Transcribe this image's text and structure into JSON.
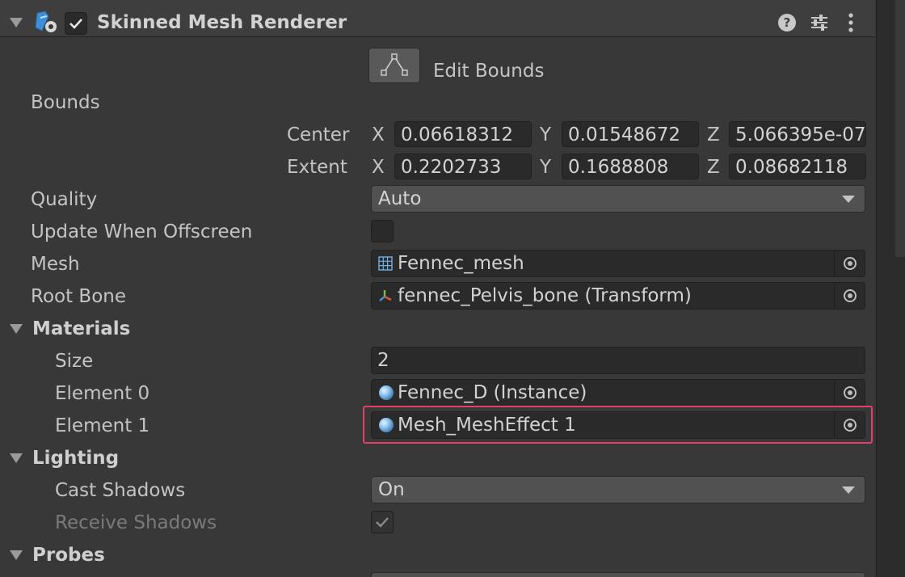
{
  "component": {
    "title": "Skinned Mesh Renderer",
    "enabled": true,
    "header_icons": [
      "component-icon",
      "help-icon",
      "presets-icon",
      "more-icon"
    ]
  },
  "edit_bounds": {
    "label": "Edit Bounds",
    "icon": "bounds-edit-icon"
  },
  "bounds": {
    "label": "Bounds",
    "center": {
      "label": "Center",
      "x_label": "X",
      "x": "0.06618312",
      "y_label": "Y",
      "y": "0.01548672",
      "z_label": "Z",
      "z": "5.066395e-07"
    },
    "extent": {
      "label": "Extent",
      "x_label": "X",
      "x": "0.2202733",
      "y_label": "Y",
      "y": "0.1688808",
      "z_label": "Z",
      "z": "0.08682118"
    }
  },
  "quality": {
    "label": "Quality",
    "value": "Auto"
  },
  "update_offscreen": {
    "label": "Update When Offscreen",
    "checked": false
  },
  "mesh": {
    "label": "Mesh",
    "value": "Fennec_mesh",
    "icon": "mesh-grid-icon"
  },
  "root_bone": {
    "label": "Root Bone",
    "value": "fennec_Pelvis_bone (Transform)",
    "icon": "transform-axes-icon"
  },
  "materials": {
    "label": "Materials",
    "size_label": "Size",
    "size": "2",
    "elements": [
      {
        "label": "Element 0",
        "value": "Fennec_D (Instance)",
        "icon": "material-sphere-icon"
      },
      {
        "label": "Element 1",
        "value": "Mesh_MeshEffect 1",
        "icon": "material-sphere-icon",
        "highlighted": true
      }
    ]
  },
  "lighting": {
    "label": "Lighting",
    "cast_shadows": {
      "label": "Cast Shadows",
      "value": "On"
    },
    "receive_shadows": {
      "label": "Receive Shadows",
      "checked": true,
      "disabled": true
    }
  },
  "probes": {
    "label": "Probes"
  },
  "colors": {
    "highlight": "#e0406a",
    "background": "#383838",
    "field": "#2a2a2a",
    "dropdown": "#515151"
  }
}
